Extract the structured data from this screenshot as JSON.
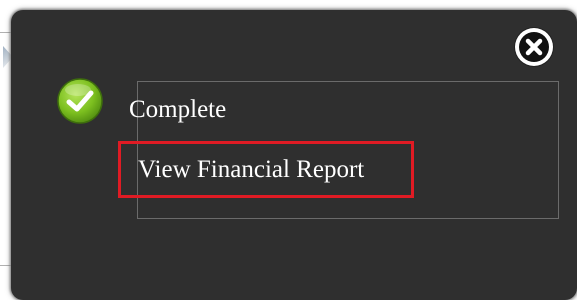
{
  "dialog": {
    "status_text": "Complete",
    "link_label": "View Financial Report",
    "close_icon": "close-circle-icon",
    "status_icon": "checkmark-icon",
    "highlight_color": "#e01b24",
    "accent_color": "#7cbf1f"
  }
}
